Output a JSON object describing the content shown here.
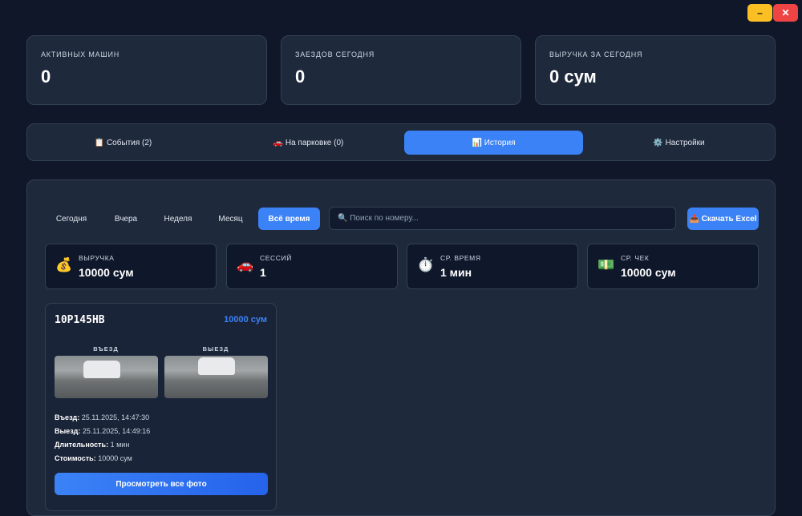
{
  "window": {
    "minimize": "–",
    "close": "✕"
  },
  "stats": [
    {
      "label": "АКТИВНЫХ МАШИН",
      "value": "0"
    },
    {
      "label": "ЗАЕЗДОВ СЕГОДНЯ",
      "value": "0"
    },
    {
      "label": "ВЫРУЧКА ЗА СЕГОДНЯ",
      "value": "0 сум"
    }
  ],
  "tabs": [
    {
      "label": "📋 События (2)"
    },
    {
      "label": "🚗 На парковке (0)"
    },
    {
      "label": "📊 История"
    },
    {
      "label": "⚙️ Настройки"
    }
  ],
  "filters": [
    "Сегодня",
    "Вчера",
    "Неделя",
    "Месяц",
    "Всё время"
  ],
  "search": {
    "placeholder": "🔍 Поиск по номеру..."
  },
  "excel": "📥 Скачать Excel",
  "summary": [
    {
      "icon": "💰",
      "label": "ВЫРУЧКА",
      "value": "10000 сум"
    },
    {
      "icon": "🚗",
      "label": "СЕССИЙ",
      "value": "1"
    },
    {
      "icon": "⏱️",
      "label": "СР. ВРЕМЯ",
      "value": "1 мин"
    },
    {
      "icon": "💵",
      "label": "СР. ЧЕК",
      "value": "10000 сум"
    }
  ],
  "record": {
    "plate": "10P145HB",
    "price": "10000 сум",
    "entry_label": "ВЪЕЗД",
    "exit_label": "ВЫЕЗД",
    "details": [
      {
        "k": "Въезд:",
        "v": "25.11.2025, 14:47:30"
      },
      {
        "k": "Выезд:",
        "v": "25.11.2025, 14:49:16"
      },
      {
        "k": "Длительность:",
        "v": "1 мин"
      },
      {
        "k": "Стоимость:",
        "v": "10000 сум"
      }
    ],
    "button": "Просмотреть все фото"
  }
}
